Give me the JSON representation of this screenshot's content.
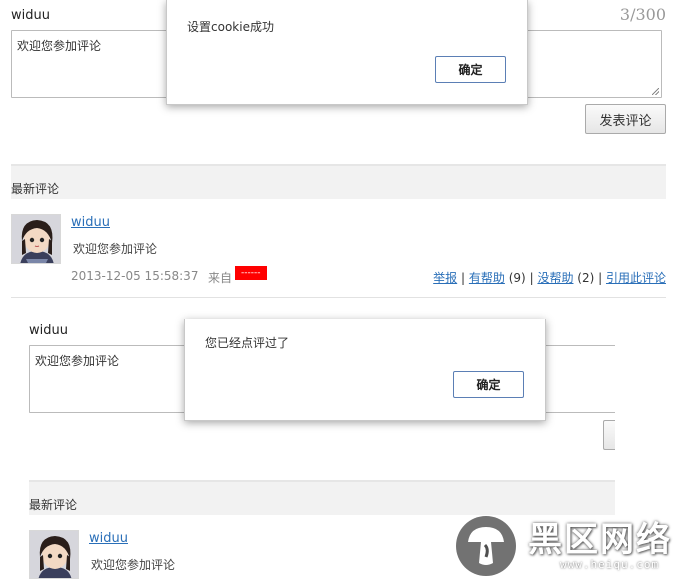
{
  "top_form": {
    "username": "widuu",
    "counter": "3/300",
    "textarea_value": "欢迎您参加评论",
    "submit_label": "发表评论"
  },
  "dialog1": {
    "message": "设置cookie成功",
    "ok_label": "确定"
  },
  "latest_title": "最新评论",
  "comment": {
    "author": "widuu",
    "text": "欢迎您参加评论",
    "timestamp": "2013-12-05 15:58:37",
    "from_label": "来自",
    "from_value": "------",
    "report_label": "举报",
    "helpful_label": "有帮助",
    "helpful_count": "(9)",
    "unhelpful_label": "没帮助",
    "unhelpful_count": "(2)",
    "quote_label": "引用此评论",
    "sep": "|"
  },
  "second_form": {
    "username": "widuu",
    "textarea_value": "欢迎您参加评论"
  },
  "dialog2": {
    "message": "您已经点评过了",
    "ok_label": "确定"
  },
  "latest_title_2": "最新评论",
  "comment2": {
    "author": "widuu",
    "text": "欢迎您参加评论"
  },
  "watermark": {
    "text": "黑区网络",
    "url": "www.heiqu.com",
    "icon": "mushroom-logo-icon"
  }
}
